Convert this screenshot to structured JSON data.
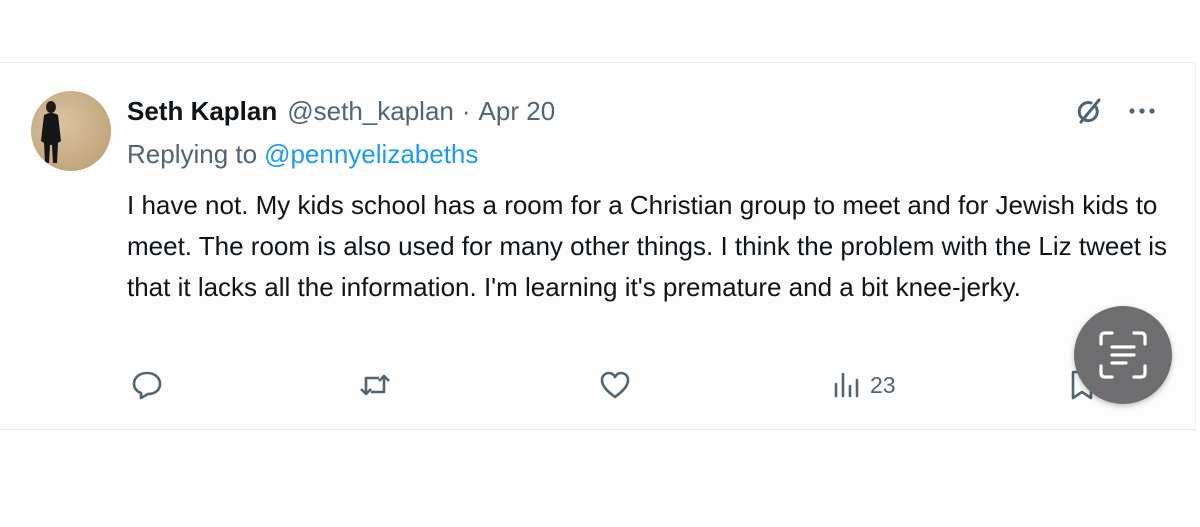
{
  "tweet": {
    "display_name": "Seth Kaplan",
    "handle": "@seth_kaplan",
    "separator": "·",
    "date": "Apr 20",
    "replying_to_label": "Replying to",
    "replying_to_handle": "@pennyelizabeths",
    "text": "I have not. My kids school has a room for a Christian group to meet and for Jewish kids to meet. The room is also used for many other things. I think the problem with the Liz tweet is that it lacks all the information. I'm learning it's premature and a bit knee-jerky."
  },
  "actions": {
    "views_count": "23"
  },
  "icons": {
    "top_right": [
      "grok-icon",
      "more-icon"
    ],
    "action_bar": [
      "reply-icon",
      "retweet-icon",
      "like-icon",
      "views-icon",
      "bookmark-icon"
    ],
    "overlay": "text-scan-icon"
  },
  "colors": {
    "name_text": "#0f1419",
    "secondary_text": "#536471",
    "mention_link": "#1d9bf0",
    "overlay_button": "#6e6e70"
  }
}
